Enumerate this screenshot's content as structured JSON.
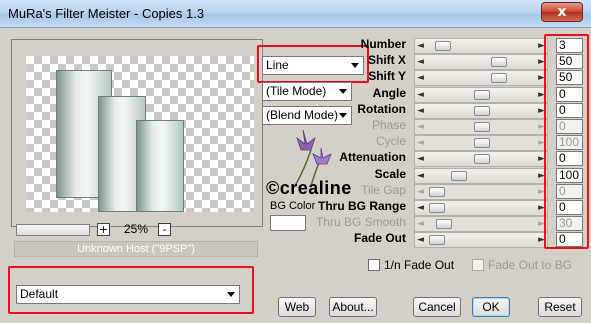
{
  "window": {
    "title": "MuRa's Filter Meister - Copies 1.3",
    "close_glyph": "x"
  },
  "preview": {
    "zoom_minus": "-",
    "zoom_plus": "+",
    "zoom_value": "25%",
    "host": "Unknown Host (\"9PSP\")"
  },
  "preset": {
    "value": "Default"
  },
  "combos": {
    "mode": "Line",
    "tile_mode": "(Tile Mode)",
    "blend_mode": "(Blend Mode)"
  },
  "logo": {
    "text": "©crealine"
  },
  "bg_color": {
    "label": "BG Color"
  },
  "params": [
    {
      "label": "Number",
      "value": "3",
      "enabled": true,
      "level": 0.08
    },
    {
      "label": "Shift X",
      "value": "50",
      "enabled": true,
      "level": 0.68
    },
    {
      "label": "Shift Y",
      "value": "50",
      "enabled": true,
      "level": 0.68
    },
    {
      "label": "Angle",
      "value": "0",
      "enabled": true,
      "level": 0.5
    },
    {
      "label": "Rotation",
      "value": "0",
      "enabled": true,
      "level": 0.5
    },
    {
      "label": "Phase",
      "value": "0",
      "enabled": false,
      "level": 0.5
    },
    {
      "label": "Cycle",
      "value": "100",
      "enabled": false,
      "level": 0.5
    },
    {
      "label": "Attenuation",
      "value": "0",
      "enabled": true,
      "level": 0.5
    },
    {
      "label": "Scale",
      "value": "100",
      "enabled": true,
      "level": 0.25
    },
    {
      "label": "Tile Gap",
      "value": "0",
      "enabled": false,
      "level": 0.02
    },
    {
      "label": "Thru BG Range",
      "value": "0",
      "enabled": true,
      "level": 0.02
    },
    {
      "label": "Thru BG Smooth",
      "value": "30",
      "enabled": false,
      "level": 0.1
    },
    {
      "label": "Fade Out",
      "value": "0",
      "enabled": true,
      "level": 0.02
    }
  ],
  "checkboxes": [
    {
      "label": "1/n Fade Out",
      "enabled": true
    },
    {
      "label": "Fade Out to BG",
      "enabled": false
    }
  ],
  "buttons": {
    "web": "Web",
    "about": "About...",
    "cancel": "Cancel",
    "ok": "OK",
    "reset": "Reset"
  },
  "accent_color": "#e8101e"
}
